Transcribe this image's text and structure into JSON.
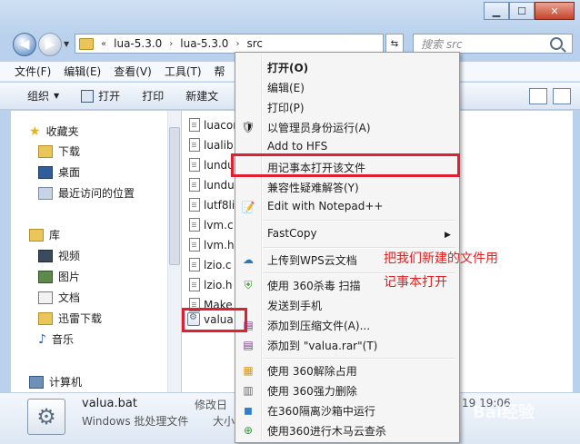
{
  "window": {
    "controls": {
      "minimize": "▁",
      "maximize": "☐",
      "close": "✕"
    }
  },
  "address": {
    "overflow": "«",
    "crumbs": [
      "lua-5.3.0",
      "lua-5.3.0",
      "src"
    ],
    "search_placeholder": "搜索 src"
  },
  "menubar": [
    "文件(F)",
    "编辑(E)",
    "查看(V)",
    "工具(T)",
    "帮"
  ],
  "toolbar": {
    "organize": "组织",
    "open": "打开",
    "print": "打印",
    "new_folder": "新建文"
  },
  "nav": {
    "favorites": "收藏夹",
    "downloads": "下载",
    "desktop": "桌面",
    "recent": "最近访问的位置",
    "libraries": "库",
    "videos": "视频",
    "pictures": "图片",
    "documents": "文档",
    "xunlei": "迅雷下载",
    "music": "音乐",
    "computer": "计算机"
  },
  "files": [
    "luacor",
    "lualib.",
    "lundu",
    "lundu",
    "lutf8lil",
    "lvm.c",
    "lvm.h",
    "lzio.c",
    "lzio.h",
    "Make",
    "valua."
  ],
  "details": {
    "name": "valua.bat",
    "type": "Windows 批处理文件",
    "modified_label": "修改日",
    "size_label": "大小",
    "date": "19 19:06"
  },
  "context_menu": {
    "open": "打开(O)",
    "edit": "编辑(E)",
    "print": "打印(P)",
    "run_as_admin": "以管理员身份运行(A)",
    "add_to_hfs": "Add to HFS",
    "open_with_notepad": "用记事本打开该文件",
    "compat": "兼容性疑难解答(Y)",
    "notepadpp": "Edit with Notepad++",
    "fastcopy": "FastCopy",
    "wps": "上传到WPS云文档",
    "scan360": "使用 360杀毒 扫描",
    "send_phone": "发送到手机",
    "add_archive": "添加到压缩文件(A)...",
    "add_rar": "添加到 \"valua.rar\"(T)",
    "unlock360": "使用 360解除占用",
    "delete360": "使用 360强力删除",
    "sandbox360": "在360隔离沙箱中运行",
    "cloud360": "使用360进行木马云查杀"
  },
  "annotations": {
    "line1": "把我们新建的文件用",
    "line2": "记事本打开"
  },
  "colors": {
    "highlight": "#e02030",
    "annotation_text": "#e02020"
  }
}
